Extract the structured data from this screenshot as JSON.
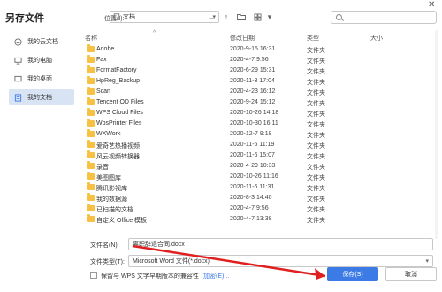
{
  "window": {
    "title": "另存文件",
    "close_icon": "close-icon"
  },
  "sidebar": {
    "items": [
      {
        "label": "我的云文档",
        "icon": "cloud-icon",
        "active": false
      },
      {
        "label": "我的电脑",
        "icon": "computer-icon",
        "active": false
      },
      {
        "label": "我的桌面",
        "icon": "desktop-icon",
        "active": false
      },
      {
        "label": "我的文档",
        "icon": "documents-icon",
        "active": true
      }
    ]
  },
  "toolbar": {
    "location_label": "位置(I):",
    "location_value": "文档",
    "search_placeholder": ""
  },
  "list": {
    "columns": [
      "名称",
      "修改日期",
      "类型",
      "大小"
    ],
    "rows": [
      {
        "name": "Adobe",
        "date": "2020-9-15 16:31",
        "type": "文件夹"
      },
      {
        "name": "Fax",
        "date": "2020-4-7 9:56",
        "type": "文件夹"
      },
      {
        "name": "FormatFactory",
        "date": "2020-6-29 15:31",
        "type": "文件夹"
      },
      {
        "name": "HpReg_Backup",
        "date": "2020-11-3 17:04",
        "type": "文件夹"
      },
      {
        "name": "Scan",
        "date": "2020-4-23 16:12",
        "type": "文件夹"
      },
      {
        "name": "Tencent OD Files",
        "date": "2020-9-24 15:12",
        "type": "文件夹"
      },
      {
        "name": "WPS Cloud Files",
        "date": "2020-10-26 14:18",
        "type": "文件夹"
      },
      {
        "name": "WpsPrinter Files",
        "date": "2020-10-30 16:11",
        "type": "文件夹"
      },
      {
        "name": "WXWork",
        "date": "2020-12-7 9:18",
        "type": "文件夹"
      },
      {
        "name": "爱奇艺热播视频",
        "date": "2020-11-6 11:19",
        "type": "文件夹"
      },
      {
        "name": "风云视频转换器",
        "date": "2020-11-6 15:07",
        "type": "文件夹"
      },
      {
        "name": "录音",
        "date": "2020-4-29 10:33",
        "type": "文件夹"
      },
      {
        "name": "美图图库",
        "date": "2020-10-26 11:16",
        "type": "文件夹"
      },
      {
        "name": "腾讯影视库",
        "date": "2020-11-6 11:31",
        "type": "文件夹"
      },
      {
        "name": "我的数据源",
        "date": "2020-8-3 14:40",
        "type": "文件夹"
      },
      {
        "name": "已扫描的文档",
        "date": "2020-4-7 9:56",
        "type": "文件夹"
      },
      {
        "name": "自定义 Office 模板",
        "date": "2020-4-7 13:38",
        "type": "文件夹"
      }
    ]
  },
  "footer": {
    "filename_label": "文件名(N):",
    "filename_value": "离职辞退合同.docx",
    "filetype_label": "文件类型(T):",
    "filetype_value": "Microsoft Word 文件(*.docx)",
    "compat_label": "保留与 WPS 文字早期版本的兼容性",
    "encrypt_label": "加密(E)...",
    "save_label": "保存(S)",
    "cancel_label": "取消"
  },
  "colors": {
    "accent": "#3c7be6",
    "sidebar_active": "#d8e3f3",
    "folder": "#f7c244",
    "annotation_arrow": "#e02020"
  }
}
